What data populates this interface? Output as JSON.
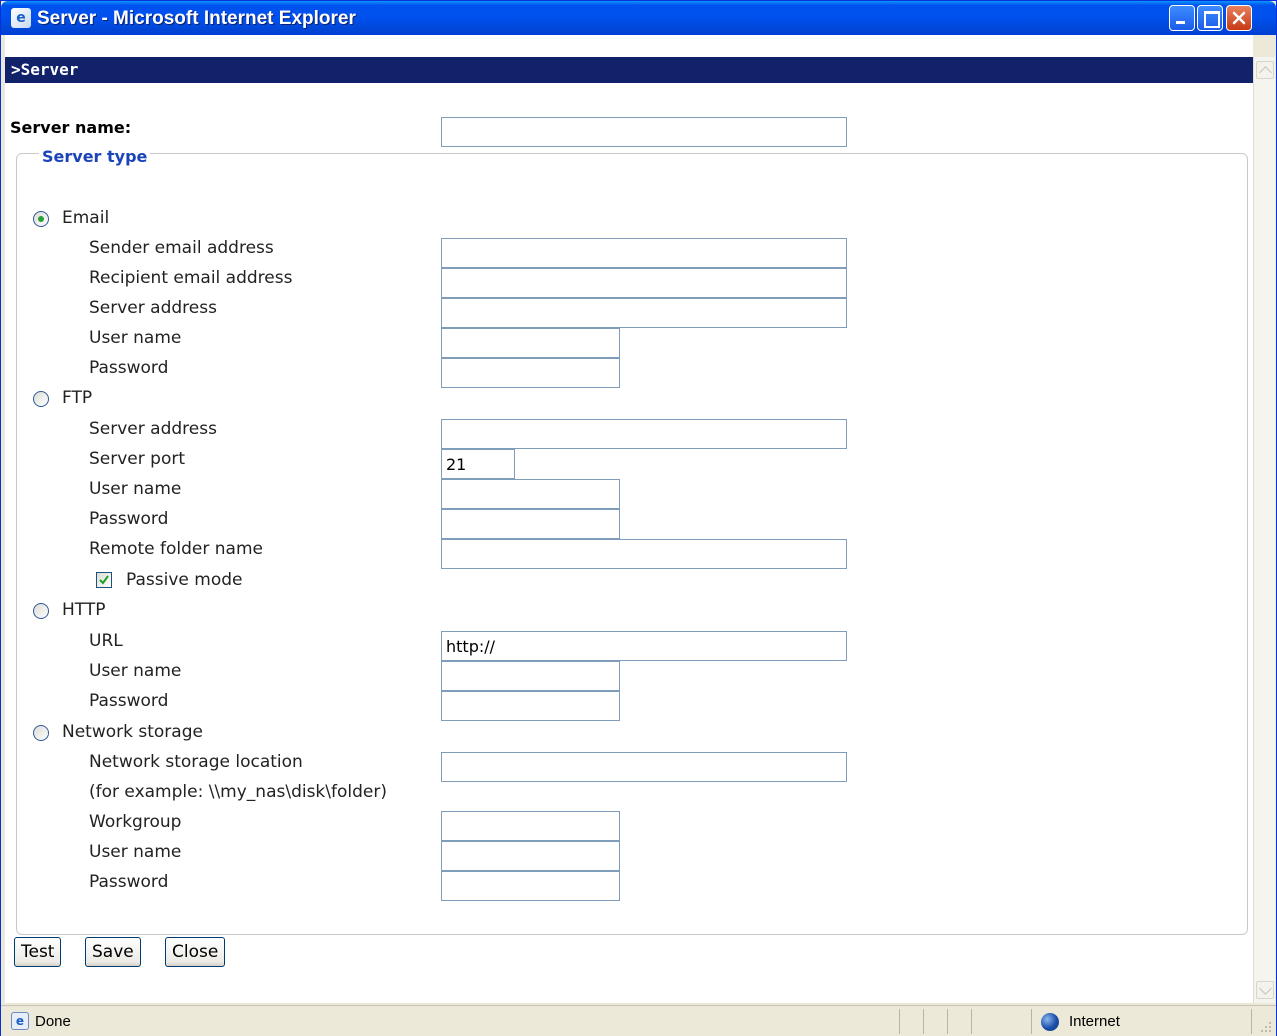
{
  "window": {
    "title": "Server - Microsoft Internet Explorer"
  },
  "page": {
    "header": ">Server",
    "server_name_label": "Server name:",
    "server_name_value": "",
    "server_type_legend": "Server type"
  },
  "email": {
    "label": "Email",
    "selected": true,
    "sender_label": "Sender email address",
    "recipient_label": "Recipient email address",
    "server_address_label": "Server address",
    "username_label": "User name",
    "password_label": "Password"
  },
  "ftp": {
    "label": "FTP",
    "selected": false,
    "server_address_label": "Server address",
    "server_port_label": "Server port",
    "server_port_value": "21",
    "username_label": "User name",
    "password_label": "Password",
    "remote_folder_label": "Remote folder name",
    "passive_mode_label": "Passive mode",
    "passive_mode_checked": true
  },
  "http": {
    "label": "HTTP",
    "selected": false,
    "url_label": "URL",
    "url_value": "http://",
    "username_label": "User name",
    "password_label": "Password"
  },
  "network_storage": {
    "label": "Network storage",
    "selected": false,
    "location_label": "Network storage location",
    "example_label": "(for example: \\\\my_nas\\disk\\folder)",
    "workgroup_label": "Workgroup",
    "username_label": "User name",
    "password_label": "Password"
  },
  "buttons": {
    "test": "Test",
    "save": "Save",
    "close": "Close"
  },
  "statusbar": {
    "status": "Done",
    "zone": "Internet"
  },
  "colors": {
    "header_bg": "#12226a",
    "legend_text": "#1a44b8",
    "input_border": "#7f9db9"
  }
}
